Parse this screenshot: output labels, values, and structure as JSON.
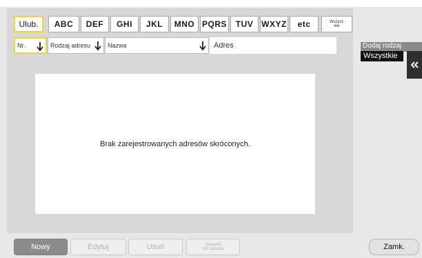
{
  "index_tabs": {
    "favorites": "Ulub.",
    "letters": [
      "ABC",
      "DEF",
      "GHI",
      "JKL",
      "MNO",
      "PQRS",
      "TUV",
      "WXYZ",
      "etc"
    ],
    "all_line1": "Wszyst-",
    "all_line2": "kie"
  },
  "columns": {
    "number": "Nr.",
    "address_type": "Rodzaj adresu",
    "name": "Nazwa",
    "address": "Adres"
  },
  "list": {
    "empty_message": "Brak zarejestrowanych adresów skróconych."
  },
  "filter": {
    "label": "Dodaj rodzaj",
    "value": "Wszystkie"
  },
  "buttons": {
    "new": "Nowy",
    "edit": "Edytuj",
    "delete": "Usuń",
    "check_line1": "Sprawdź",
    "check_line2": "ust.zadania",
    "close": "Zamk."
  },
  "colors": {
    "highlight": "#f3d23a",
    "panel": "#d7d7d7"
  }
}
